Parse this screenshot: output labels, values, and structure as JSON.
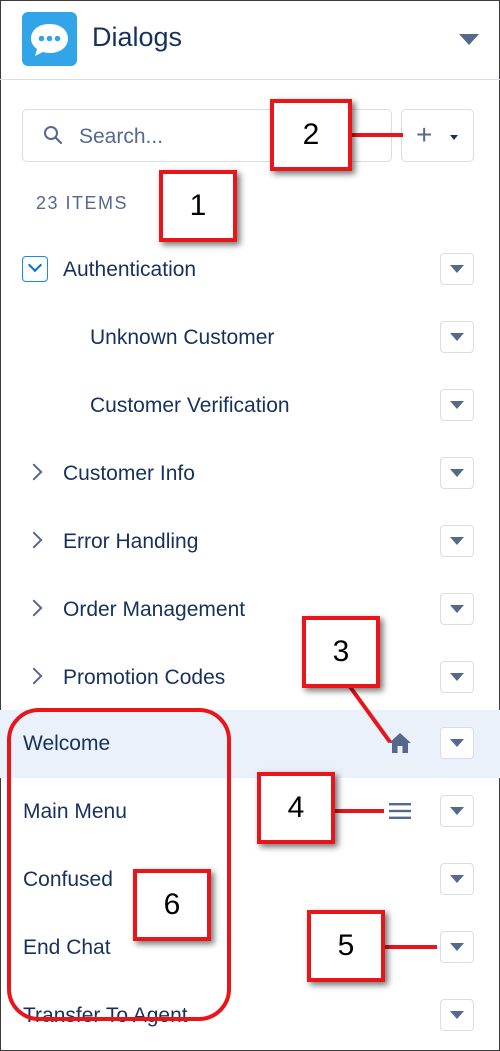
{
  "header": {
    "title": "Dialogs",
    "app_icon": "chat-bubble-icon",
    "accent": "#32a5e8"
  },
  "search": {
    "placeholder": "Search..."
  },
  "toolbar": {
    "add_label": "+"
  },
  "count": "23 ITEMS",
  "items": [
    {
      "label": "Authentication",
      "expandable": true,
      "expanded": true
    },
    {
      "label": "Unknown Customer",
      "indent": 1
    },
    {
      "label": "Customer Verification",
      "indent": 1
    },
    {
      "label": "Customer Info",
      "expandable": true,
      "expanded": false
    },
    {
      "label": "Error Handling",
      "expandable": true,
      "expanded": false
    },
    {
      "label": "Order Management",
      "expandable": true,
      "expanded": false
    },
    {
      "label": "Promotion Codes",
      "expandable": true,
      "expanded": false
    },
    {
      "label": "Welcome",
      "selected": true,
      "status_icon": "home-icon"
    },
    {
      "label": "Main Menu",
      "status_icon": "menu-lines-icon"
    },
    {
      "label": "Confused"
    },
    {
      "label": "End Chat"
    },
    {
      "label": "Transfer To Agent"
    }
  ],
  "callouts": [
    "1",
    "2",
    "3",
    "4",
    "5",
    "6"
  ],
  "colors": {
    "text": "#16325c",
    "muted": "#54698d",
    "selected_row": "#eaf1fb",
    "callout": "#e8161b"
  }
}
